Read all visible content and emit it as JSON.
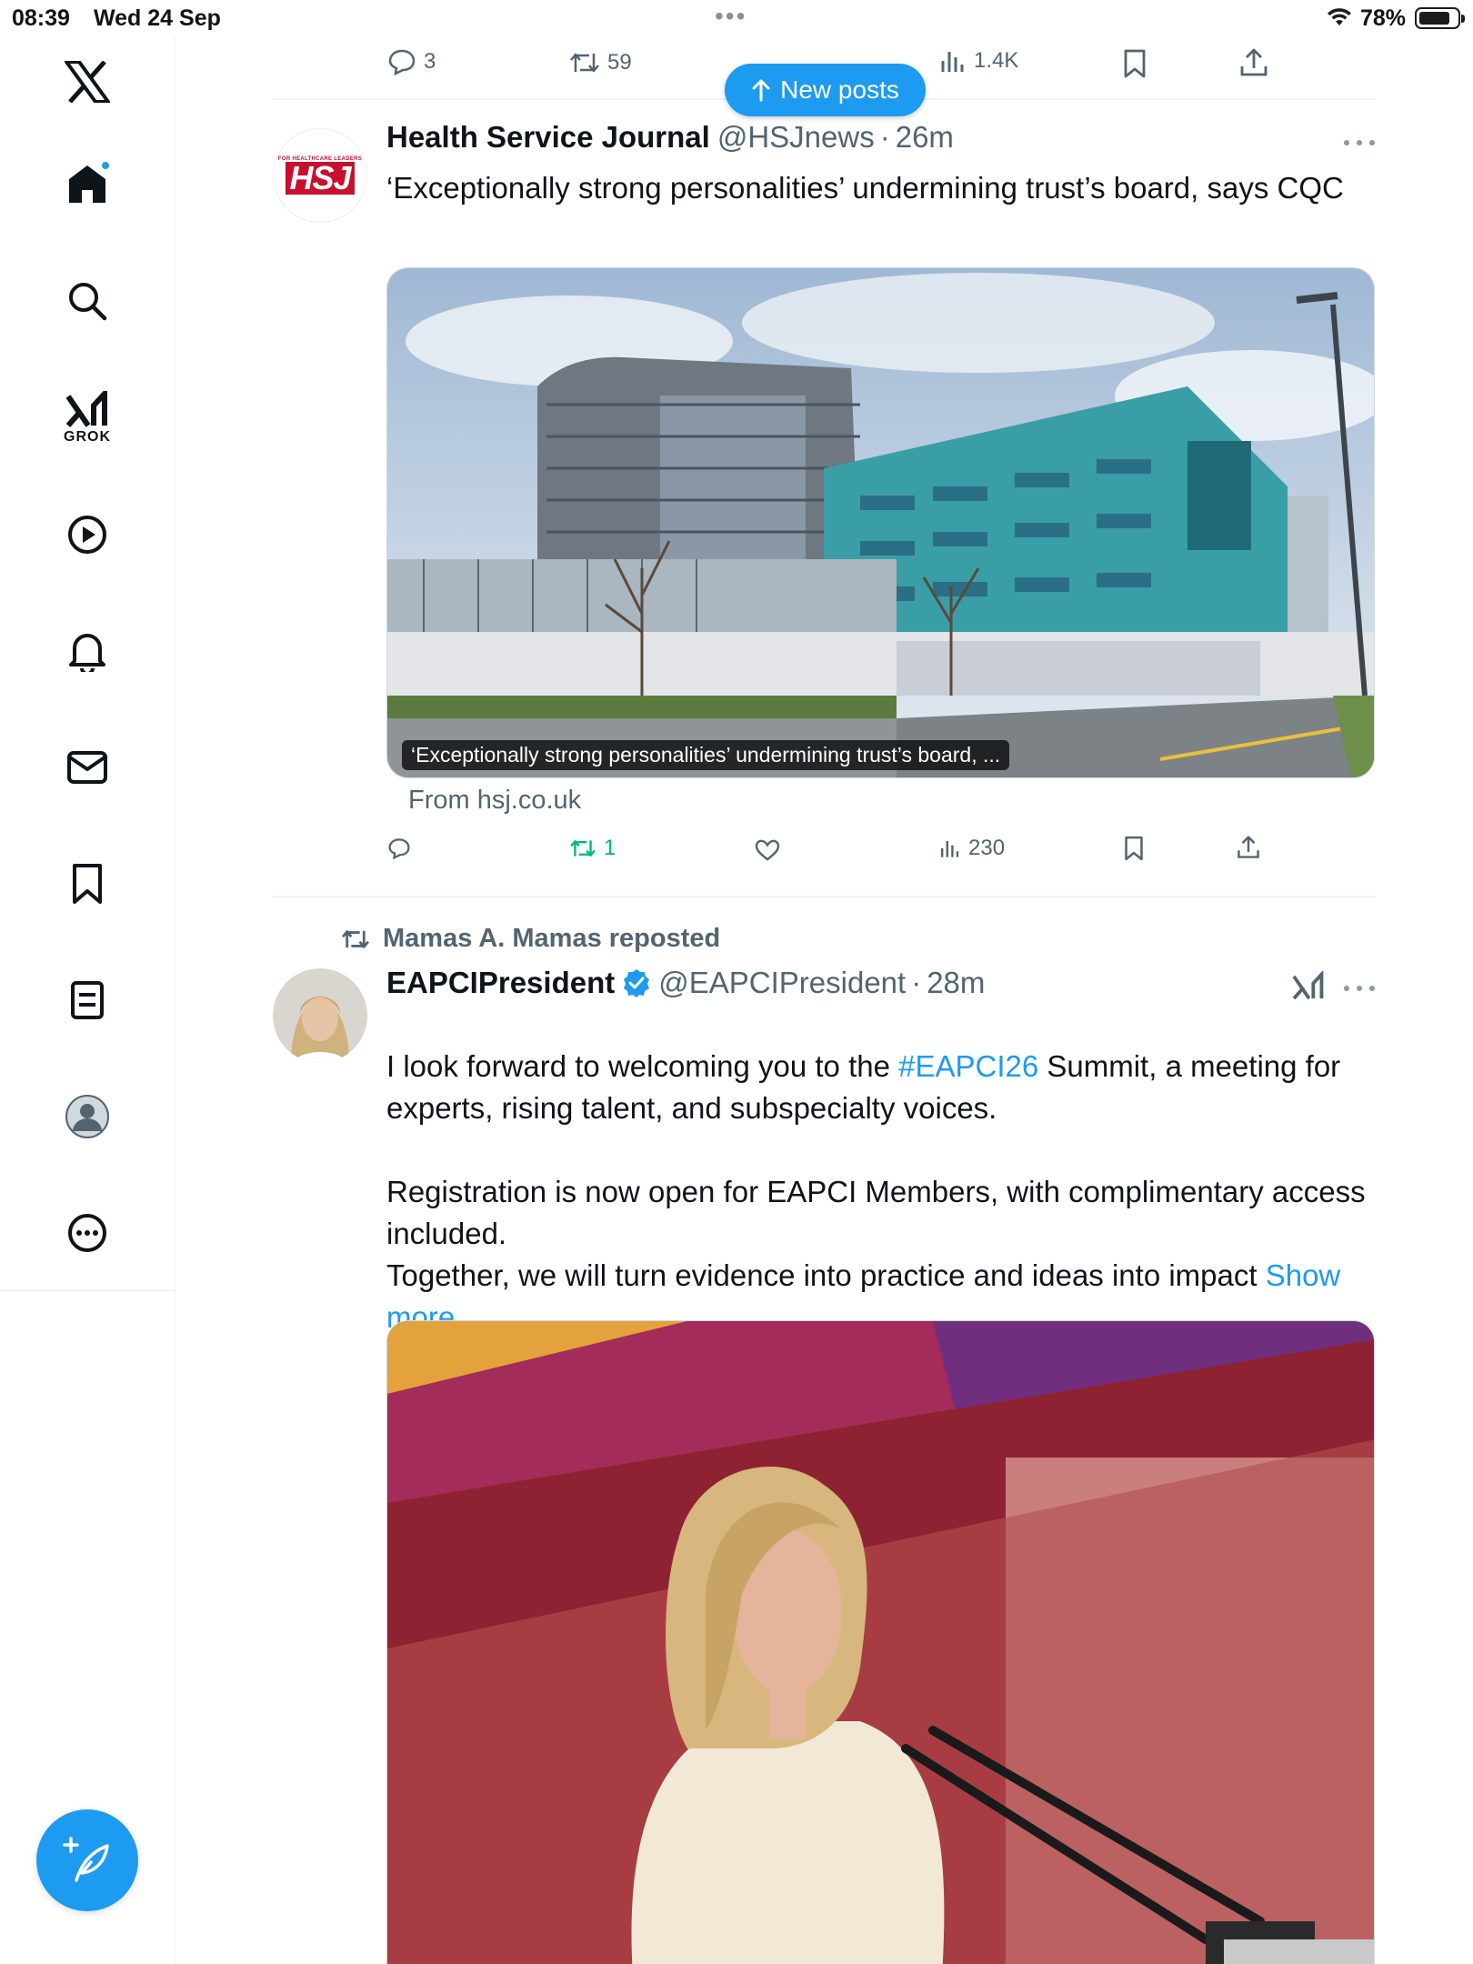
{
  "status_bar": {
    "time": "08:39",
    "date": "Wed 24 Sep",
    "battery": "78%"
  },
  "sidebar": {
    "grok_label": "GROK",
    "items": [
      "x-logo",
      "home-icon",
      "search-icon",
      "grok-icon",
      "video-icon",
      "bell-icon",
      "mail-icon",
      "bookmark-icon",
      "list-icon",
      "profile-icon",
      "more-icon"
    ]
  },
  "new_posts": "New posts",
  "prev_tweet": {
    "replies": "3",
    "reposts": "59",
    "views": "1.4K"
  },
  "tweet1": {
    "name": "Health Service Journal",
    "handle": "@HSJnews",
    "dot": "·",
    "time": "26m",
    "avatar_small": "FOR HEALTHCARE LEADERS",
    "avatar_big": "HSJ",
    "text": "‘Exceptionally strong personalities’ undermining trust’s board, says CQC",
    "card_caption": "‘Exceptionally strong personalities’ undermining trust’s board, ...",
    "from": "From hsj.co.uk",
    "replies": "",
    "reposts": "1",
    "views": "230"
  },
  "tweet2": {
    "reposted_by": "Mamas A. Mamas reposted",
    "name": "EAPCIPresident",
    "handle": "@EAPCIPresident",
    "dot": "·",
    "time": "28m",
    "text_a": "I look forward to welcoming you to the ",
    "hashtag": "#EAPCI26",
    "text_b": " Summit, a meeting for experts, rising talent, and subspecialty voices.",
    "text_c": "Registration is now open for EAPCI Members, with complimentary access included.",
    "text_d": "Together, we will turn evidence into practice and ideas into impact ",
    "show_more": "Show more"
  },
  "colors": {
    "accent": "#1d9bf0",
    "repost_green": "#00ba7c",
    "secondary_text": "#536471"
  }
}
